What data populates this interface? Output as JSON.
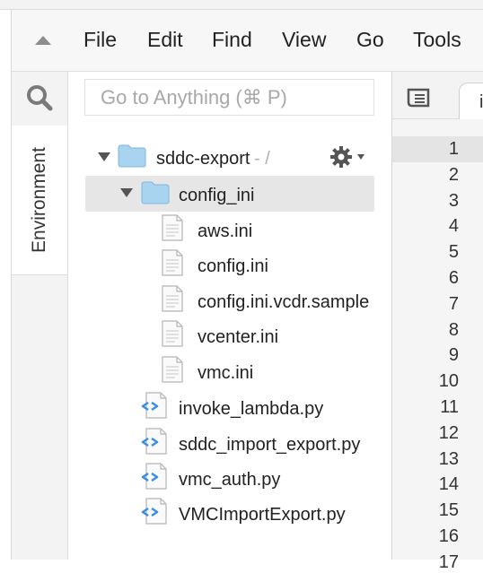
{
  "menubar": {
    "items": [
      "File",
      "Edit",
      "Find",
      "View",
      "Go",
      "Tools"
    ]
  },
  "side_tabs": {
    "environment": "Environment"
  },
  "search": {
    "placeholder": "Go to Anything (⌘ P)"
  },
  "tree": {
    "root": {
      "name": "sddc-export",
      "suffix": "- /"
    },
    "folder": {
      "name": "config_ini"
    },
    "folder_files": [
      "aws.ini",
      "config.ini",
      "config.ini.vcdr.sample",
      "vcenter.ini",
      "vmc.ini"
    ],
    "root_files": [
      "invoke_lambda.py",
      "sddc_import_export.py",
      "vmc_auth.py",
      "VMCImportExport.py"
    ]
  },
  "editor": {
    "tab_label": "i",
    "line_numbers": [
      "1",
      "2",
      "3",
      "4",
      "5",
      "6",
      "7",
      "8",
      "9",
      "10",
      "11",
      "12",
      "13",
      "14",
      "15",
      "16",
      "17"
    ]
  },
  "colors": {
    "folder_icon": "#a9d4f0",
    "python_icon": "#3b8ee0",
    "selected_row": "#e6e6e6"
  }
}
